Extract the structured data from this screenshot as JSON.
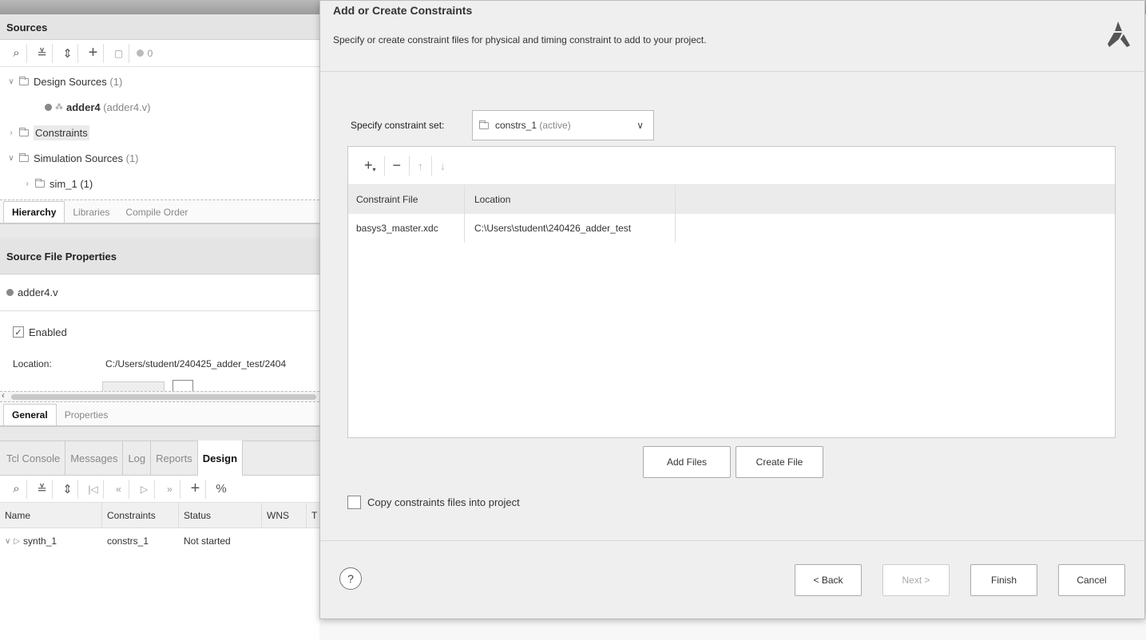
{
  "sources": {
    "title": "Sources",
    "toolbar_count": "0",
    "tree": {
      "design_sources": "Design Sources",
      "design_sources_count": "(1)",
      "adder_name": "adder4",
      "adder_file": "(adder4.v)",
      "constraints": "Constraints",
      "sim_sources": "Simulation Sources",
      "sim_sources_count": "(1)",
      "sim_1": "sim_1",
      "sim_1_count": "(1)"
    },
    "tabs": [
      "Hierarchy",
      "Libraries",
      "Compile Order"
    ]
  },
  "file_props": {
    "title": "Source File Properties",
    "file": "adder4.v",
    "enabled_label": "Enabled",
    "location_label": "Location:",
    "location_value": "C:/Users/student/240425_adder_test/2404",
    "tabs": [
      "General",
      "Properties"
    ]
  },
  "console": {
    "tabs": [
      "Tcl Console",
      "Messages",
      "Log",
      "Reports",
      "Design"
    ],
    "columns": [
      "Name",
      "Constraints",
      "Status",
      "WNS",
      "T"
    ],
    "rows": [
      {
        "name": "synth_1",
        "constraints": "constrs_1",
        "status": "Not started"
      }
    ]
  },
  "dialog": {
    "title": "Add or Create Constraints",
    "subtitle": "Specify or create constraint files for physical and timing constraint to add to your project.",
    "set_label": "Specify constraint set:",
    "set_value": "constrs_1",
    "set_suffix": "(active)",
    "table": {
      "headers": [
        "Constraint File",
        "Location"
      ],
      "rows": [
        {
          "file": "basys3_master.xdc",
          "location": "C:\\Users\\student\\240426_adder_test"
        }
      ]
    },
    "add_files": "Add Files",
    "create_file": "Create File",
    "copy_label": "Copy constraints files into project",
    "buttons": {
      "back": "< Back",
      "next": "Next >",
      "finish": "Finish",
      "cancel": "Cancel"
    },
    "help": "?"
  },
  "colors": {
    "dialog_bg": "#efefef",
    "panel_header": "#e4e4e4",
    "logo": "#555555"
  }
}
